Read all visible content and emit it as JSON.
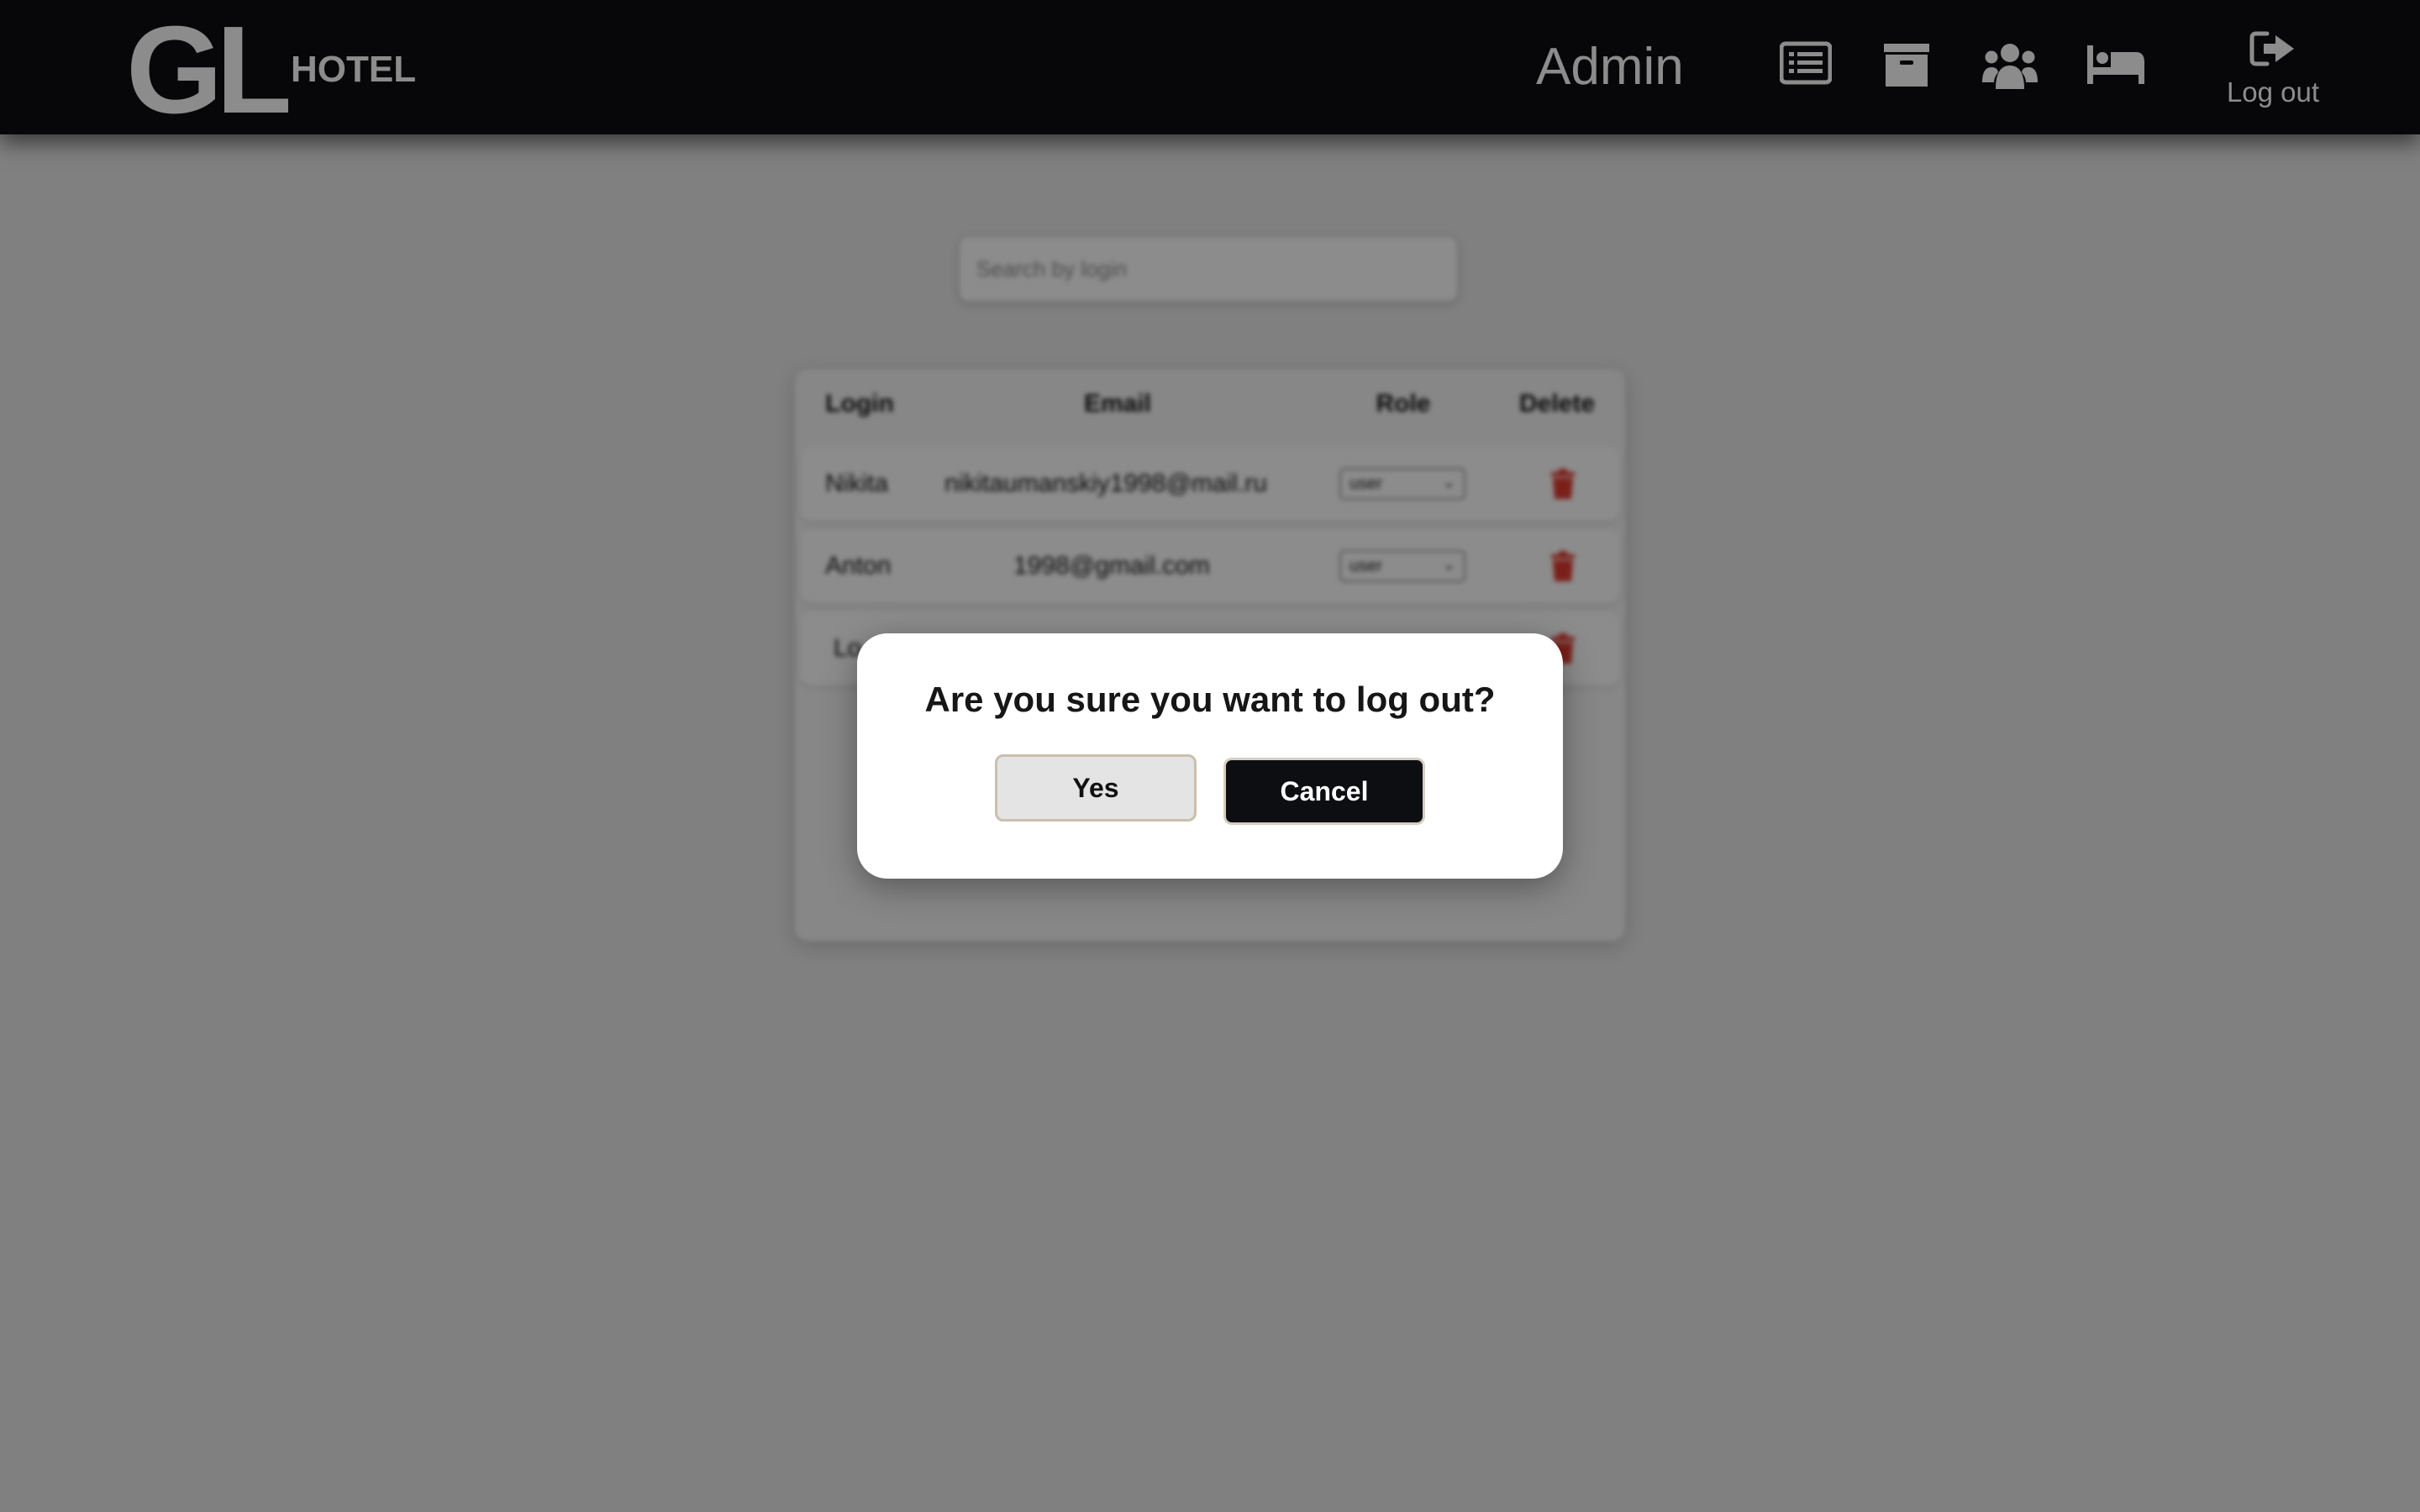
{
  "header": {
    "logo_main": "GL",
    "logo_sub": "HOTEL",
    "admin_name": "Admin",
    "nav": [
      {
        "icon": "list-icon"
      },
      {
        "icon": "archive-icon"
      },
      {
        "icon": "users-icon"
      },
      {
        "icon": "bed-icon"
      }
    ],
    "logout_label": "Log out"
  },
  "search": {
    "placeholder": "Search by login"
  },
  "table": {
    "columns": [
      "Login",
      "Email",
      "Role",
      "Delete"
    ],
    "rows": [
      {
        "login": "Nikita",
        "email": "nikitaumanskiy1998@mail.ru",
        "role": "user"
      },
      {
        "login": "Anton",
        "email": "1998@gmail.com",
        "role": "user"
      },
      {
        "login": "Lo",
        "email": "",
        "role": ""
      }
    ]
  },
  "modal": {
    "title": "Are you sure you want to log out?",
    "yes_label": "Yes",
    "cancel_label": "Cancel"
  },
  "colors": {
    "header_bg": "#0d0e12",
    "delete_red": "#e03a2f",
    "cancel_bg": "#0d0e12"
  }
}
